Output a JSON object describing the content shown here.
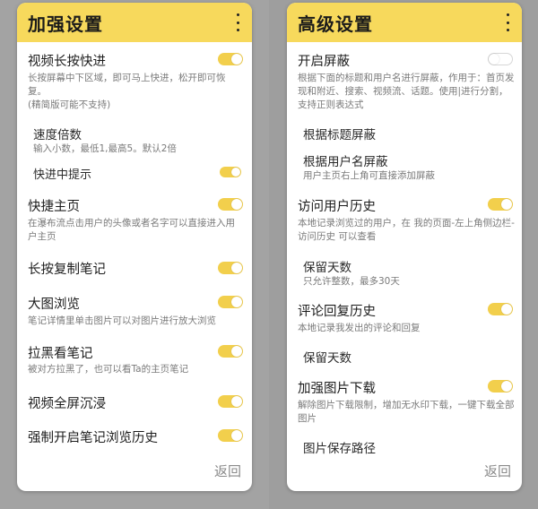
{
  "left": {
    "title": "加强设置",
    "back_label": "返回",
    "rows": [
      {
        "title": "视频长按快进",
        "desc": "长按屏幕中下区域，即可马上快进，松开即可恢复。",
        "desc2": "(精简版可能不支持)",
        "toggle": "on"
      },
      {
        "title": "速度倍数",
        "desc": "输入小数，最低1,最高5。默认2倍"
      },
      {
        "title": "快进中提示",
        "toggle": "on"
      },
      {
        "title": "快捷主页",
        "desc": "在瀑布流点击用户的头像或者名字可以直接进入用户主页",
        "toggle": "on"
      },
      {
        "title": "长按复制笔记",
        "toggle": "on"
      },
      {
        "title": "大图浏览",
        "desc": "笔记详情里单击图片可以对图片进行放大浏览",
        "toggle": "on"
      },
      {
        "title": "拉黑看笔记",
        "desc": "被对方拉黑了，也可以看Ta的主页笔记",
        "toggle": "on"
      },
      {
        "title": "视频全屏沉浸",
        "toggle": "on"
      },
      {
        "title": "强制开启笔记浏览历史",
        "toggle": "on"
      }
    ]
  },
  "right": {
    "title": "高级设置",
    "back_label": "返回",
    "rows": [
      {
        "title": "开启屏蔽",
        "desc": "根据下面的标题和用户名进行屏蔽，作用于：首页发现和附近、搜索、视频流、话题。使用|进行分割，支持正则表达式",
        "toggle": "off"
      },
      {
        "title": "根据标题屏蔽"
      },
      {
        "title": "根据用户名屏蔽",
        "desc": "用户主页右上角可直接添加屏蔽"
      },
      {
        "title": "访问用户历史",
        "desc": "本地记录浏览过的用户，在 我的页面-左上角侧边栏-访问历史 可以查看",
        "toggle": "on"
      },
      {
        "title": "保留天数",
        "desc": "只允许整数，最多30天"
      },
      {
        "title": "评论回复历史",
        "desc": "本地记录我发出的评论和回复",
        "toggle": "on"
      },
      {
        "title": "保留天数"
      },
      {
        "title": "加强图片下载",
        "desc": "解除图片下载限制，增加无水印下载，一键下载全部图片",
        "toggle": "on"
      },
      {
        "title": "图片保存路径"
      }
    ]
  },
  "colors": {
    "header": "#f7d95c",
    "toggle_on": "#f2cf4c"
  },
  "icons": {
    "menu": "more-vertical-icon"
  }
}
